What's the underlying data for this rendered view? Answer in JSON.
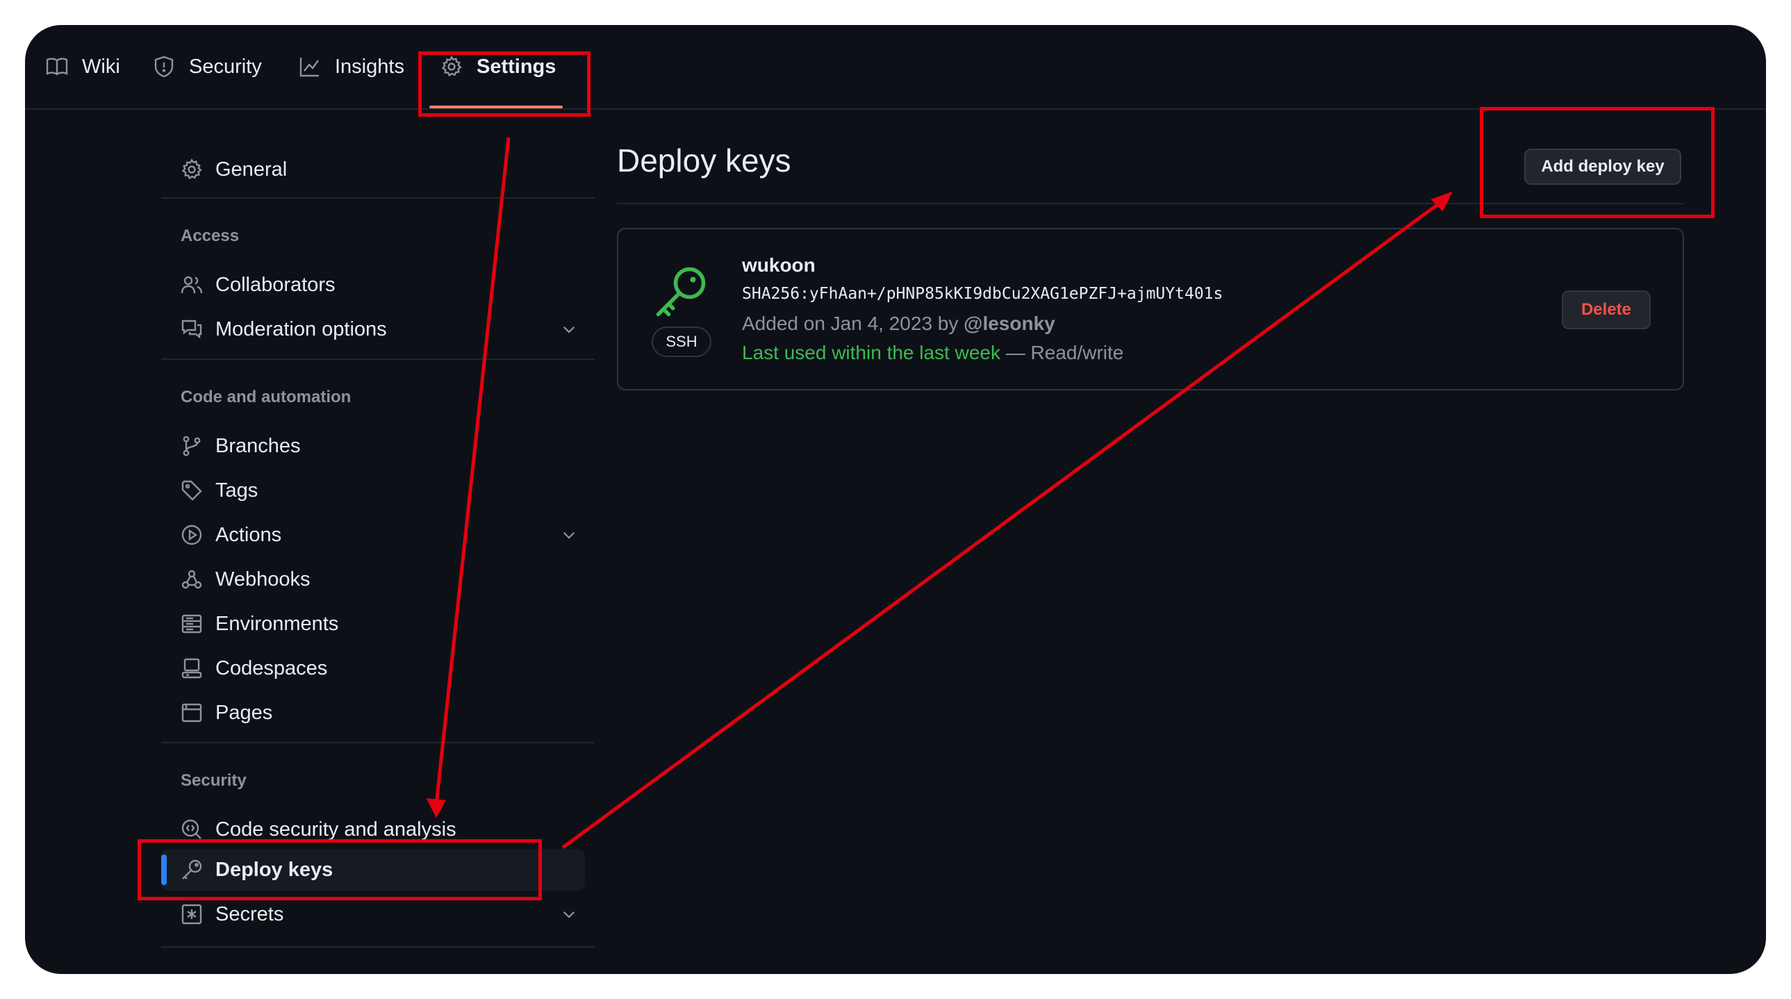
{
  "nav": {
    "tabs": [
      {
        "label": "Wiki",
        "icon": "book-icon"
      },
      {
        "label": "Security",
        "icon": "shield-icon"
      },
      {
        "label": "Insights",
        "icon": "graph-icon"
      },
      {
        "label": "Settings",
        "icon": "gear-icon",
        "selected": true
      }
    ]
  },
  "sidebar": {
    "general": "General",
    "sections": [
      {
        "heading": "Access",
        "items": [
          "Collaborators",
          "Moderation options"
        ]
      },
      {
        "heading": "Code and automation",
        "items": [
          "Branches",
          "Tags",
          "Actions",
          "Webhooks",
          "Environments",
          "Codespaces",
          "Pages"
        ]
      },
      {
        "heading": "Security",
        "items": [
          "Code security and analysis",
          "Deploy keys",
          "Secrets"
        ]
      }
    ],
    "active": "Deploy keys"
  },
  "main": {
    "title": "Deploy keys",
    "add_button": "Add deploy key",
    "key": {
      "name": "wukoon",
      "fingerprint": "SHA256:yFhAan+/pHNP85kKI9dbCu2XAG1ePZFJ+ajmUYt401s",
      "added_prefix": "Added on Jan 4, 2023 by",
      "added_by": "@lesonky",
      "last_used": "Last used within the last week",
      "access": "— Read/write",
      "type_badge": "SSH",
      "delete_button": "Delete"
    }
  },
  "colors": {
    "background": "#0d1117",
    "accent_blue": "#2f81f7",
    "tab_underline": "#f78166",
    "success_green": "#3fb950",
    "danger_red": "#f85149",
    "annotation_red": "#e5000f"
  }
}
